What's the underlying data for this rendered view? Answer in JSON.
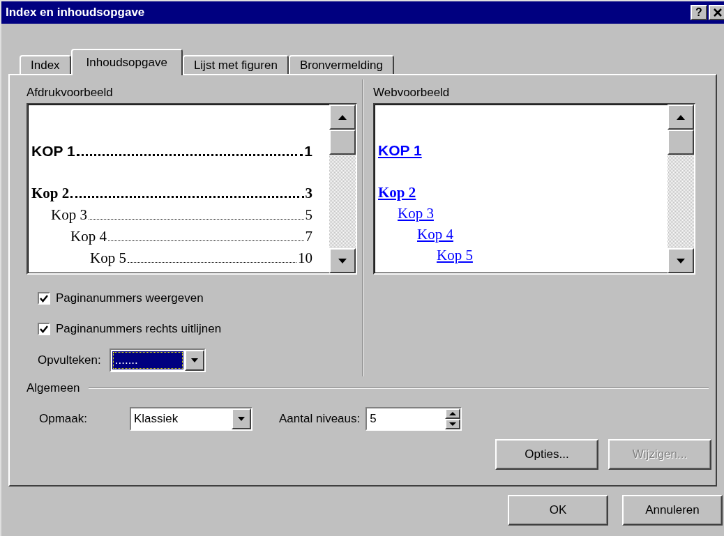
{
  "window": {
    "title": "Index en inhoudsopgave",
    "help": "?"
  },
  "tabs": [
    {
      "label": "Index",
      "selected": false
    },
    {
      "label": "Inhoudsopgave",
      "selected": true
    },
    {
      "label": "Lijst met figuren",
      "selected": false
    },
    {
      "label": "Bronvermelding",
      "selected": false
    }
  ],
  "print_preview": {
    "label": "Afdrukvoorbeeld",
    "entries": [
      {
        "kind": "kop1",
        "text": "KOP 1",
        "page": "1"
      },
      {
        "kind": "kop2",
        "text": "Kop 2",
        "page": "3",
        "children": [
          {
            "kind": "kop3",
            "text": "Kop 3",
            "page": "5",
            "children": [
              {
                "kind": "kop3",
                "text": "Kop 4",
                "page": "7",
                "children": [
                  {
                    "kind": "kop3",
                    "text": "Kop 5",
                    "page": "10"
                  }
                ]
              }
            ]
          }
        ]
      }
    ]
  },
  "web_preview": {
    "label": "Webvoorbeeld",
    "entries": [
      {
        "kind": "kop1",
        "text": "KOP 1"
      },
      {
        "kind": "kop2",
        "text": "Kop 2",
        "children": [
          {
            "kind": "kop3",
            "text": "Kop 3",
            "children": [
              {
                "kind": "kop3",
                "text": "Kop 4",
                "children": [
                  {
                    "kind": "kop3",
                    "text": "Kop 5"
                  }
                ]
              }
            ]
          }
        ]
      }
    ]
  },
  "checkboxes": [
    {
      "label": "Paginanummers weergeven",
      "checked": true
    },
    {
      "label": "Paginanummers rechts uitlijnen",
      "checked": true
    }
  ],
  "leader": {
    "label": "Opvulteken:",
    "value": ".......",
    "focused": true
  },
  "general": {
    "label": "Algemeen",
    "format": {
      "label": "Opmaak:",
      "value": "Klassiek"
    },
    "levels": {
      "label": "Aantal niveaus:",
      "value": "5"
    }
  },
  "panel_buttons": [
    {
      "label": "Opties...",
      "disabled": false
    },
    {
      "label": "Wijzigen...",
      "disabled": true
    }
  ],
  "dialog_buttons": [
    "OK",
    "Annuleren"
  ]
}
